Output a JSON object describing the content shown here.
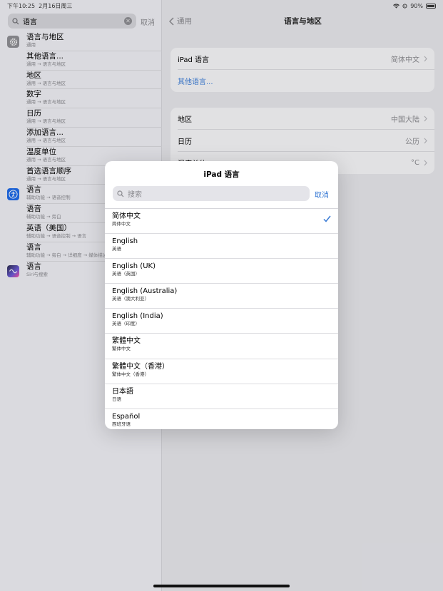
{
  "status_bar": {
    "time": "下午10:25",
    "date": "2月16日周三",
    "battery": "90%"
  },
  "sidebar": {
    "search_value": "语言",
    "cancel_label": "取消",
    "results": [
      {
        "title": "语言与地区",
        "subtitle": "通用",
        "icon": "gear-icon"
      },
      {
        "title": "其他语言...",
        "subtitle": "通用 → 语言与地区"
      },
      {
        "title": "地区",
        "subtitle": "通用 → 语言与地区"
      },
      {
        "title": "数字",
        "subtitle": "通用 → 语言与地区"
      },
      {
        "title": "日历",
        "subtitle": "通用 → 语言与地区"
      },
      {
        "title": "添加语言...",
        "subtitle": "通用 → 语言与地区"
      },
      {
        "title": "温度单位",
        "subtitle": "通用 → 语言与地区"
      },
      {
        "title": "首选语言顺序",
        "subtitle": "通用 → 语言与地区"
      },
      {
        "title": "语言",
        "subtitle": "辅助功能 → 语音控制",
        "icon": "accessibility-icon"
      },
      {
        "title": "语音",
        "subtitle": "辅助功能 → 旁白"
      },
      {
        "title": "英语（美国）",
        "subtitle": "辅助功能 → 语音控制 → 语言"
      },
      {
        "title": "语言",
        "subtitle": "辅助功能 → 旁白 → 详细度 → 媒体描述"
      },
      {
        "title": "语言",
        "subtitle": "Siri与搜索",
        "icon": "siri-icon"
      }
    ]
  },
  "detail": {
    "back_label": "通用",
    "title": "语言与地区",
    "group1": [
      {
        "label": "iPad 语言",
        "value": "简体中文"
      },
      {
        "label": "其他语言...",
        "value": ""
      }
    ],
    "group2": [
      {
        "label": "地区",
        "value": "中国大陆"
      },
      {
        "label": "日历",
        "value": "公历"
      },
      {
        "label": "温度单位",
        "value": "°C"
      }
    ]
  },
  "modal": {
    "title": "iPad 语言",
    "search_placeholder": "搜索",
    "cancel_label": "取消",
    "languages": [
      {
        "name": "简体中文",
        "native": "简体中文",
        "selected": true
      },
      {
        "name": "English",
        "native": "英语"
      },
      {
        "name": "English (UK)",
        "native": "英语（英国）"
      },
      {
        "name": "English (Australia)",
        "native": "英语（澳大利亚）"
      },
      {
        "name": "English (India)",
        "native": "英语（印度）"
      },
      {
        "name": "繁體中文",
        "native": "繁体中文"
      },
      {
        "name": "繁體中文（香港）",
        "native": "繁体中文（香港）"
      },
      {
        "name": "日本語",
        "native": "日语"
      },
      {
        "name": "Español",
        "native": "西班牙语"
      }
    ]
  },
  "colors": {
    "accent": "#3a7bd5",
    "secondary_text": "#8a8a8f"
  }
}
